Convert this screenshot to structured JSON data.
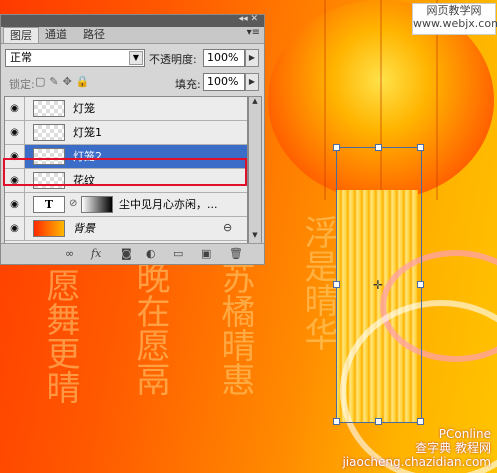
{
  "panel": {
    "tabs": [
      "图层",
      "通道",
      "路径"
    ],
    "blend_mode": "正常",
    "opacity_label": "不透明度:",
    "opacity_value": "100%",
    "lock_label": "锁定:",
    "fill_label": "填充:",
    "fill_value": "100%",
    "layers": [
      {
        "name": "灯笼",
        "visible": true,
        "selected": false
      },
      {
        "name": "灯笼1",
        "visible": true,
        "selected": false
      },
      {
        "name": "灯笼2",
        "visible": true,
        "selected": true
      },
      {
        "name": "花纹",
        "visible": true,
        "selected": false
      },
      {
        "name": "尘中见月心亦闲，...",
        "visible": true,
        "selected": false,
        "type": "text",
        "thumb_label": "T"
      },
      {
        "name": "背景",
        "visible": true,
        "selected": false,
        "locked": true
      }
    ]
  },
  "watermark_top": {
    "line1": "网页教学网",
    "line2": "www.webjx.com"
  },
  "watermark_bottom": {
    "line1": "PConline",
    "line2": "查字典 教程网",
    "line3": "jiaocheng.chazidian.com"
  },
  "colors": {
    "selection": "#3a6cc8",
    "highlight_box": "#e0102a"
  }
}
